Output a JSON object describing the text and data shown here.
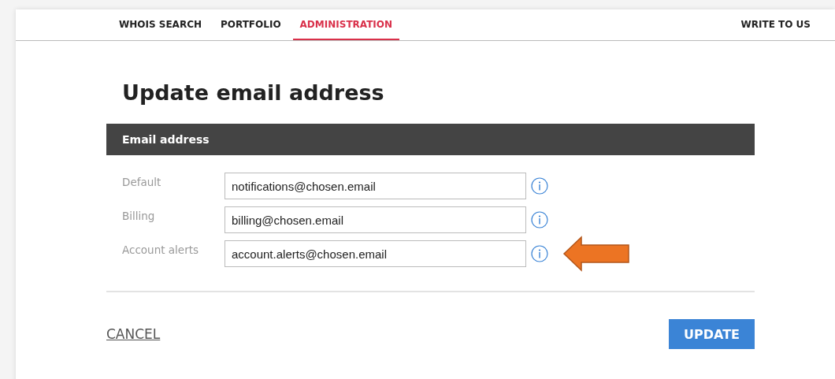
{
  "nav": {
    "tabs": [
      {
        "label": "WHOIS SEARCH",
        "selected": false
      },
      {
        "label": "PORTFOLIO",
        "selected": false
      },
      {
        "label": "ADMINISTRATION",
        "selected": true
      }
    ],
    "contact": "WRITE TO US"
  },
  "title": "Update email address",
  "section": {
    "header": "Email address",
    "fields": [
      {
        "label": "Default",
        "value": "notifications@chosen.email",
        "highlighted": false
      },
      {
        "label": "Billing",
        "value": "billing@chosen.email",
        "highlighted": false
      },
      {
        "label": "Account alerts",
        "value": "account.alerts@chosen.email",
        "highlighted": true
      }
    ]
  },
  "cancel": "CANCEL",
  "submit": "UPDATE"
}
